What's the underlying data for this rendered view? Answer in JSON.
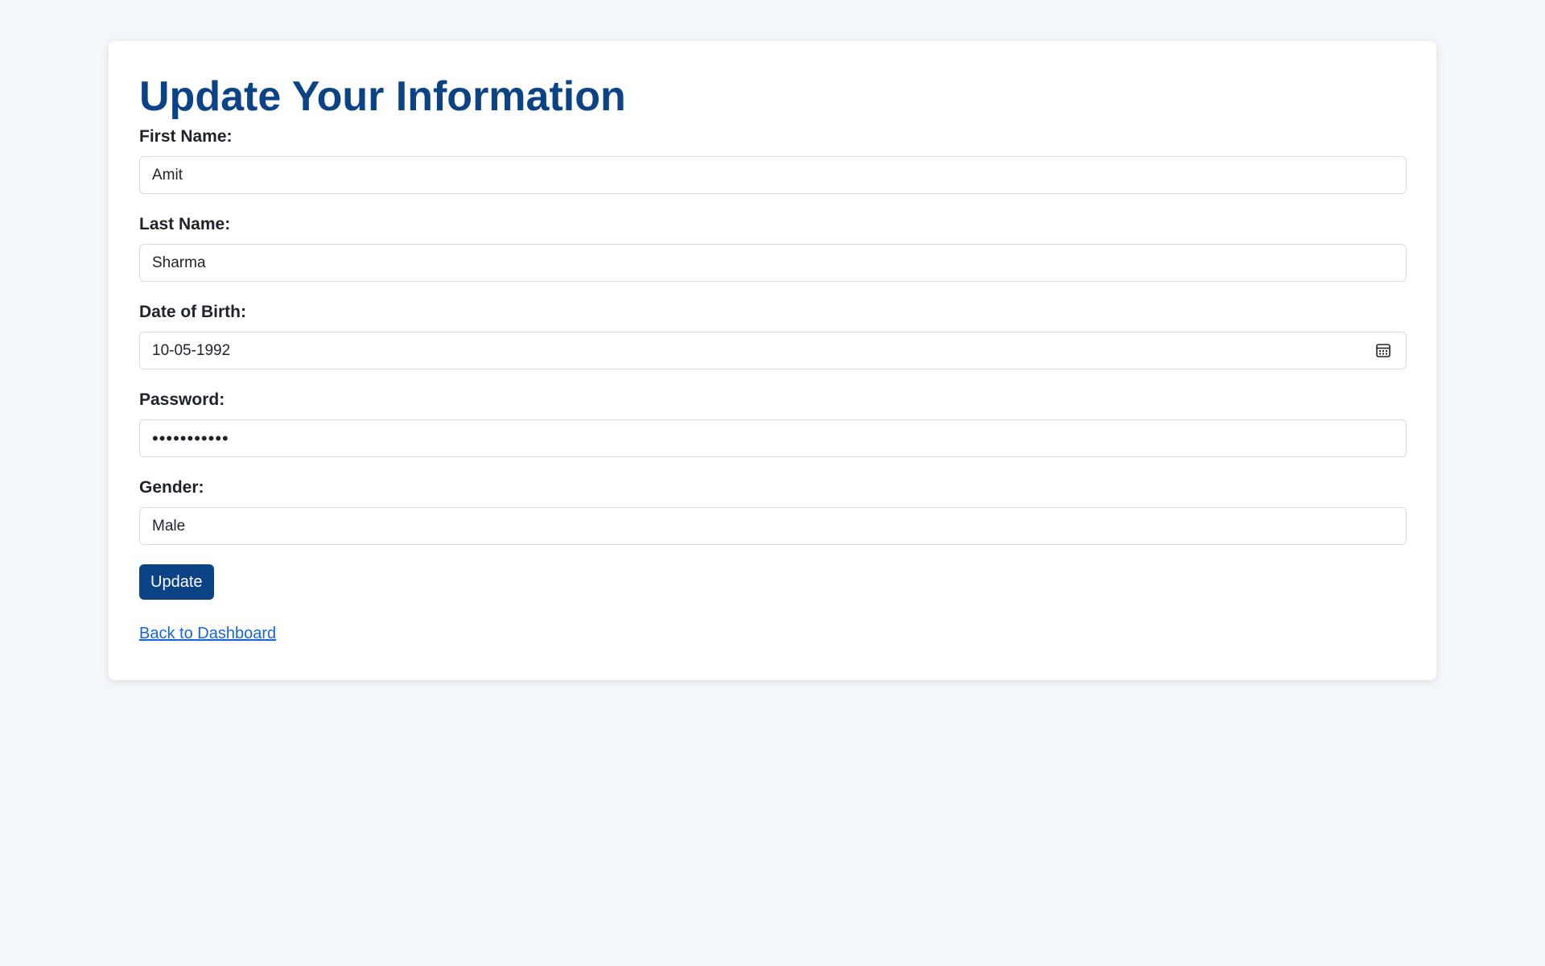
{
  "page": {
    "title": "Update Your Information"
  },
  "form": {
    "first_name": {
      "label": "First Name:",
      "value": "Amit"
    },
    "last_name": {
      "label": "Last Name:",
      "value": "Sharma"
    },
    "dob": {
      "label": "Date of Birth:",
      "value": "10-05-1992",
      "icon": "calendar-icon"
    },
    "password": {
      "label": "Password:",
      "value": "•••••••••••"
    },
    "gender": {
      "label": "Gender:",
      "value": "Male"
    },
    "submit_label": "Update"
  },
  "links": {
    "back": "Back to Dashboard"
  },
  "colors": {
    "background": "#f3f6fb",
    "card": "#ffffff",
    "title": "#0b4386",
    "button": "#0b4386",
    "link": "#1565d8",
    "input_border": "#d7dce2"
  }
}
